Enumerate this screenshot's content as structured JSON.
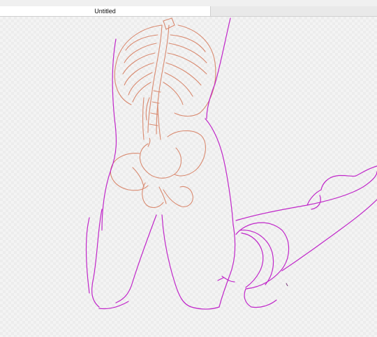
{
  "document": {
    "title": "Untitled"
  },
  "colors": {
    "figure_outline": "#c026c9",
    "skeleton_sketch": "#d98a70",
    "canvas_checker": "#ececec",
    "canvas_base": "#f4f4f4"
  }
}
